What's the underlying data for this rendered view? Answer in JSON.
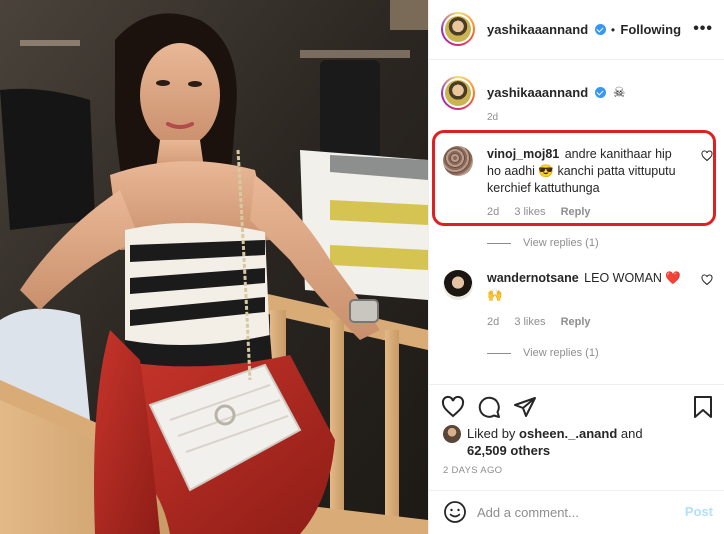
{
  "post": {
    "username": "yashikaaannand",
    "follow_label": "Following",
    "more_label": "•••",
    "separator": "•"
  },
  "caption": {
    "username": "yashikaaannand",
    "emoji": "☠",
    "time": "2d"
  },
  "comments": [
    {
      "username": "vinoj_moj81",
      "text": "andre kanithaar hip ho aadhi 😎 kanchi patta vittuputu kerchief kattuthunga",
      "time": "2d",
      "likes": "3 likes",
      "reply_label": "Reply",
      "view_replies": "View replies (1)"
    },
    {
      "username": "wandernotsane",
      "text": "LEO WOMAN ❤️🙌",
      "time": "2d",
      "likes": "3 likes",
      "reply_label": "Reply",
      "view_replies": "View replies (1)"
    }
  ],
  "likes_line": {
    "prefix": "Liked by ",
    "user": "osheen._.anand",
    "middle": " and",
    "count": "62,509 others"
  },
  "post_date": "2 DAYS AGO",
  "add_comment": {
    "placeholder": "Add a comment...",
    "post_label": "Post"
  },
  "icons": {
    "like": "heart-icon",
    "comment": "comment-icon",
    "share": "paper-plane-icon",
    "save": "bookmark-icon",
    "emoji": "smiley-icon",
    "more": "more-horizontal-icon"
  },
  "colors": {
    "text": "#262626",
    "muted": "#8e8e8e",
    "verified": "#3897f0",
    "post_disabled": "#b2dffc",
    "highlight": "#e02020"
  }
}
